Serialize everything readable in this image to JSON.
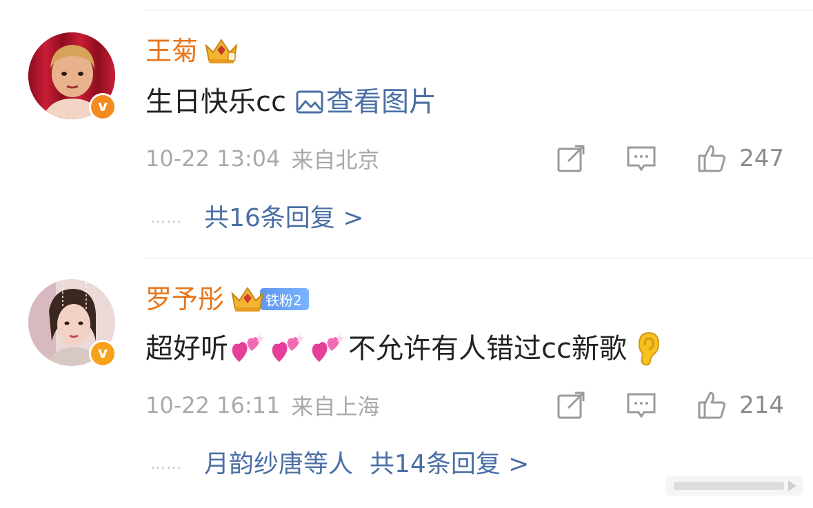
{
  "comments": [
    {
      "username": "王菊",
      "text": "生日快乐cc",
      "link_label": "查看图片",
      "time": "10-22 13:04",
      "location": "来自北京",
      "likes": "247",
      "replies_label": "共16条回复 >",
      "dots": "……"
    },
    {
      "username": "罗予彤",
      "fan_badge": "铁粉2",
      "text_before": "超好听",
      "text_after": "不允许有人错过cc新歌",
      "time": "10-22 16:11",
      "location": "来自上海",
      "likes": "214",
      "reply_users": "月韵纱唐等人",
      "replies_label": "共14条回复 >",
      "dots": "……"
    }
  ],
  "verified_badge": "v",
  "colors": {
    "username": "#e8751a",
    "link": "#4a6fa5",
    "meta": "#a9a9a9",
    "badge": "#f58a1f",
    "fan_badge": "#6aa3f5"
  },
  "icons": [
    "crown-icon",
    "image-icon",
    "share-icon",
    "comment-icon",
    "like-icon",
    "heart-emoji-icon",
    "ear-emoji-icon",
    "vip-crown-icon"
  ]
}
